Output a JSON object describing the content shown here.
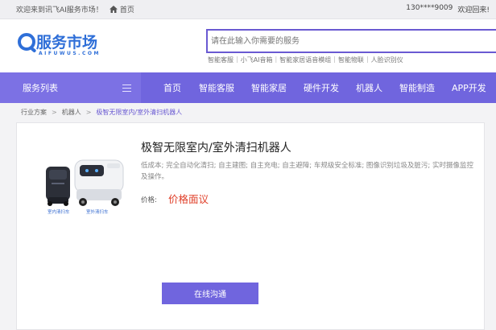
{
  "topbar": {
    "welcome": "欢迎来到讯飞AI服务市场！",
    "home": "首页",
    "phone": "130****9009",
    "greeting": "欢迎回来!"
  },
  "logo": {
    "text": "服务市场",
    "sub": "AIFUWUS.COM"
  },
  "search": {
    "placeholder": "请在此输入你需要的服务"
  },
  "hot_links": [
    "智能客服",
    "小飞AI音箱",
    "智能家居语音模组",
    "智能物联",
    "人脸识别仪"
  ],
  "nav": {
    "side_label": "服务列表",
    "items": [
      "首页",
      "智能客服",
      "智能家居",
      "硬件开发",
      "机器人",
      "智能制造",
      "APP开发"
    ]
  },
  "breadcrumb": [
    "行业方案",
    "机器人",
    "极智无限室内/室外清扫机器人"
  ],
  "product": {
    "title": "极智无限室内/室外清扫机器人",
    "description": "低成本; 完全自动化清扫; 自主建图; 自主充电; 自主避障; 车规级安全标准; 图像识别垃圾及脏污; 实时摄像监控及操作。",
    "price_label": "价格:",
    "price_value": "价格面议",
    "caption_indoor": "室内清扫车",
    "caption_outdoor": "室外清扫车",
    "contact_button": "在线沟通"
  },
  "colors": {
    "brand": "#2f6fd8",
    "nav": "#7065de",
    "price": "#e0402a"
  }
}
